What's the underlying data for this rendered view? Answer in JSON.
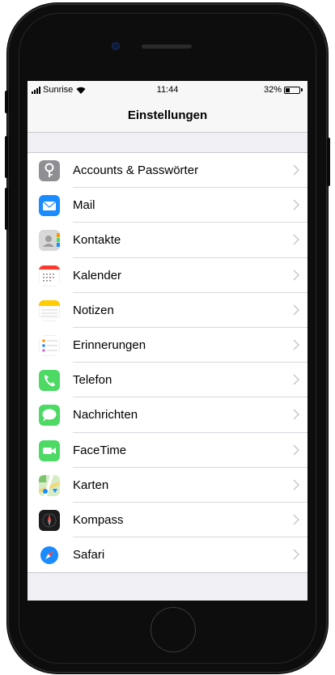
{
  "status_bar": {
    "carrier": "Sunrise",
    "time": "11:44",
    "battery": "32%",
    "battery_level": 0.32
  },
  "nav": {
    "title": "Einstellungen"
  },
  "settings": {
    "items": [
      {
        "label": "Accounts & Passwörter",
        "icon": "key-icon",
        "color": "#8e8e93"
      },
      {
        "label": "Mail",
        "icon": "mail-icon",
        "color": "#1a8cff"
      },
      {
        "label": "Kontakte",
        "icon": "contacts-icon",
        "color": "#9e9e9e"
      },
      {
        "label": "Kalender",
        "icon": "calendar-icon",
        "color": "#ff3b30"
      },
      {
        "label": "Notizen",
        "icon": "notes-icon",
        "color": "#ffcc00"
      },
      {
        "label": "Erinnerungen",
        "icon": "reminders-icon",
        "color": "#ffffff"
      },
      {
        "label": "Telefon",
        "icon": "phone-icon",
        "color": "#4cd964"
      },
      {
        "label": "Nachrichten",
        "icon": "messages-icon",
        "color": "#4cd964"
      },
      {
        "label": "FaceTime",
        "icon": "facetime-icon",
        "color": "#4cd964"
      },
      {
        "label": "Karten",
        "icon": "maps-icon",
        "color": "#7ec56e"
      },
      {
        "label": "Kompass",
        "icon": "compass-icon",
        "color": "#1c1c1e"
      },
      {
        "label": "Safari",
        "icon": "safari-icon",
        "color": "#1a8cff"
      }
    ]
  }
}
